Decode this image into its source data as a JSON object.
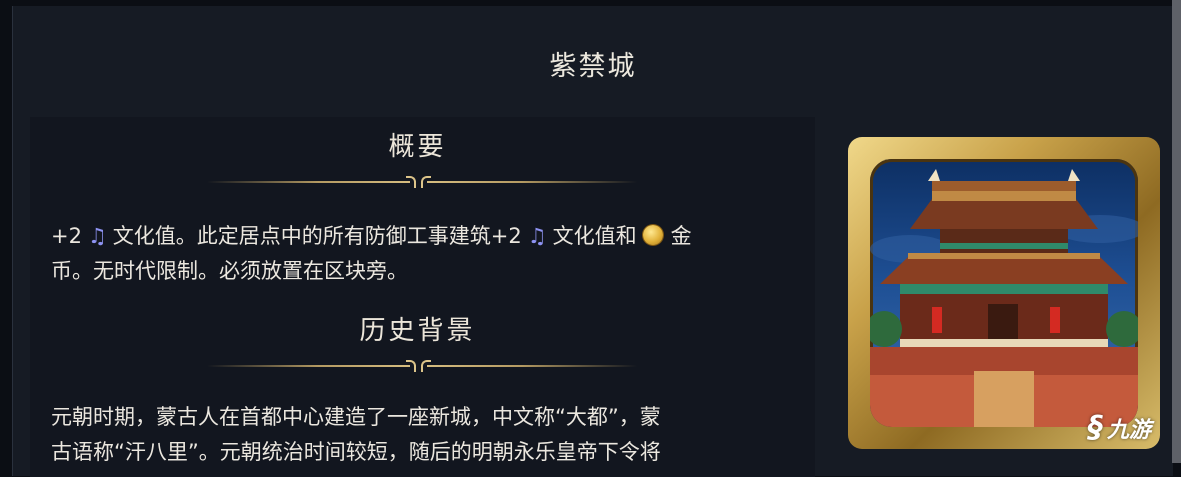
{
  "window": {
    "title": "紫禁城"
  },
  "summary": {
    "heading": "概要",
    "line1_a": "+2",
    "line1_b": "文化值。此定居点中的所有防御工事建筑+2",
    "line1_c": "文化值和",
    "line1_d": "金",
    "line2": "币。无时代限制。必须放置在区块旁。",
    "icons": {
      "culture": "culture-note-icon",
      "gold": "gold-coin-icon"
    }
  },
  "history": {
    "heading": "历史背景",
    "line1": "元朝时期，蒙古人在首都中心建造了一座新城，中文称“大都”，蒙",
    "line2": "古语称“汗八里”。元朝统治时间较短，随后的明朝永乐皇帝下令将"
  },
  "portrait": {
    "icon": "forbidden-city-building-icon"
  },
  "watermark": {
    "text": "九游"
  },
  "colors": {
    "accent_gold": "#d6bd80",
    "culture_purple": "#8e93f2",
    "panel_bg": "#161b24"
  }
}
